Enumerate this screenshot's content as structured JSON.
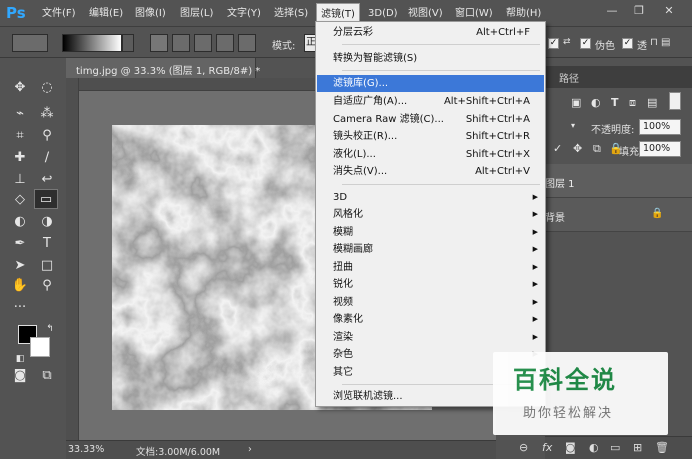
{
  "app": {
    "logo": "Ps"
  },
  "menubar": {
    "items": [
      "文件(F)",
      "编辑(E)",
      "图像(I)",
      "图层(L)",
      "文字(Y)",
      "选择(S)",
      "滤镜(T)",
      "3D(D)",
      "视图(V)",
      "窗口(W)",
      "帮助(H)"
    ],
    "active": "滤镜(T)"
  },
  "options_bar": {
    "mode_label": "模式:",
    "mode_value": "正",
    "fake_label": "伪色",
    "transparency_label": "透",
    "checked": "✓"
  },
  "document": {
    "tab_label": "timg.jpg @ 33.3% (图层 1, RGB/8#) *",
    "zoom": "33.33%",
    "doc_size": "文档:3.00M/6.00M"
  },
  "panel": {
    "tab_paths": "路径",
    "opacity_label": "不透明度:",
    "opacity_value": "100%",
    "fill_label": "填充:",
    "fill_value": "100%",
    "layers": [
      {
        "name": "图层 1"
      },
      {
        "name": "背景"
      }
    ]
  },
  "filter_menu": {
    "items": [
      {
        "label": "分层云彩",
        "shortcut": "Alt+Ctrl+F"
      },
      {
        "label": "转换为智能滤镜(S)",
        "shortcut": ""
      },
      {
        "label": "滤镜库(G)...",
        "shortcut": "",
        "highlighted": true
      },
      {
        "label": "自适应广角(A)...",
        "shortcut": "Alt+Shift+Ctrl+A"
      },
      {
        "label": "Camera Raw 滤镜(C)...",
        "shortcut": "Shift+Ctrl+A"
      },
      {
        "label": "镜头校正(R)...",
        "shortcut": "Shift+Ctrl+R"
      },
      {
        "label": "液化(L)...",
        "shortcut": "Shift+Ctrl+X"
      },
      {
        "label": "消失点(V)...",
        "shortcut": "Alt+Ctrl+V"
      },
      {
        "label": "3D",
        "submenu": true
      },
      {
        "label": "风格化",
        "submenu": true
      },
      {
        "label": "模糊",
        "submenu": true
      },
      {
        "label": "模糊画廊",
        "submenu": true
      },
      {
        "label": "扭曲",
        "submenu": true
      },
      {
        "label": "锐化",
        "submenu": true
      },
      {
        "label": "视频",
        "submenu": true
      },
      {
        "label": "像素化",
        "submenu": true
      },
      {
        "label": "渲染",
        "submenu": true
      },
      {
        "label": "杂色",
        "submenu": true
      },
      {
        "label": "其它",
        "submenu": true
      },
      {
        "label": "浏览联机滤镜...",
        "shortcut": ""
      }
    ]
  },
  "watermark": {
    "title": "百科全说",
    "subtitle": "助你轻松解决"
  },
  "colors": {
    "accent": "#3c78d8",
    "ps_blue": "#31a8ff",
    "watermark_green": "#1e8b46"
  }
}
